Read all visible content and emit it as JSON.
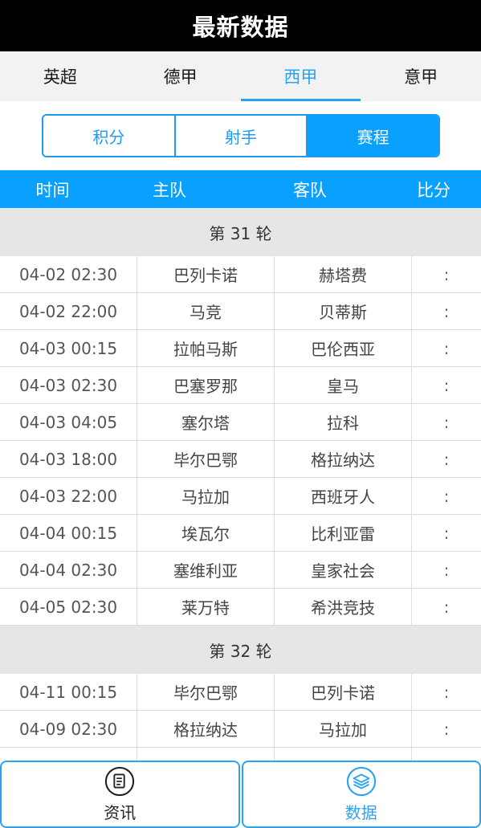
{
  "title": "最新数据",
  "league_tabs": [
    {
      "label": "英超"
    },
    {
      "label": "德甲"
    },
    {
      "label": "西甲"
    },
    {
      "label": "意甲"
    }
  ],
  "active_league_index": 2,
  "segments": [
    {
      "label": "积分"
    },
    {
      "label": "射手"
    },
    {
      "label": "赛程"
    }
  ],
  "active_segment_index": 2,
  "columns": {
    "time": "时间",
    "home": "主队",
    "away": "客队",
    "score": "比分"
  },
  "rounds": [
    {
      "label": "第 31 轮",
      "matches": [
        {
          "time": "04-02 02:30",
          "home": "巴列卡诺",
          "away": "赫塔费",
          "score": ":"
        },
        {
          "time": "04-02 22:00",
          "home": "马竞",
          "away": "贝蒂斯",
          "score": ":"
        },
        {
          "time": "04-03 00:15",
          "home": "拉帕马斯",
          "away": "巴伦西亚",
          "score": ":"
        },
        {
          "time": "04-03 02:30",
          "home": "巴塞罗那",
          "away": "皇马",
          "score": ":"
        },
        {
          "time": "04-03 04:05",
          "home": "塞尔塔",
          "away": "拉科",
          "score": ":"
        },
        {
          "time": "04-03 18:00",
          "home": "毕尔巴鄂",
          "away": "格拉纳达",
          "score": ":"
        },
        {
          "time": "04-03 22:00",
          "home": "马拉加",
          "away": "西班牙人",
          "score": ":"
        },
        {
          "time": "04-04 00:15",
          "home": "埃瓦尔",
          "away": "比利亚雷",
          "score": ":"
        },
        {
          "time": "04-04 02:30",
          "home": "塞维利亚",
          "away": "皇家社会",
          "score": ":"
        },
        {
          "time": "04-05 02:30",
          "home": "莱万特",
          "away": "希洪竞技",
          "score": ":"
        }
      ]
    },
    {
      "label": "第 32 轮",
      "matches": [
        {
          "time": "04-11 00:15",
          "home": "毕尔巴鄂",
          "away": "巴列卡诺",
          "score": ":"
        },
        {
          "time": "04-09 02:30",
          "home": "格拉纳达",
          "away": "马拉加",
          "score": ":"
        },
        {
          "time": "",
          "home": "",
          "away": "",
          "score": ""
        }
      ]
    }
  ],
  "bottom_nav": [
    {
      "label": "资讯",
      "icon": "news-icon"
    },
    {
      "label": "数据",
      "icon": "data-layers-icon"
    }
  ],
  "active_nav_index": 1,
  "colors": {
    "accent": "#0aa0ff",
    "tab_active": "#2aa3f5",
    "titlebar_bg": "#000000",
    "round_bg": "#e6e6e6"
  }
}
